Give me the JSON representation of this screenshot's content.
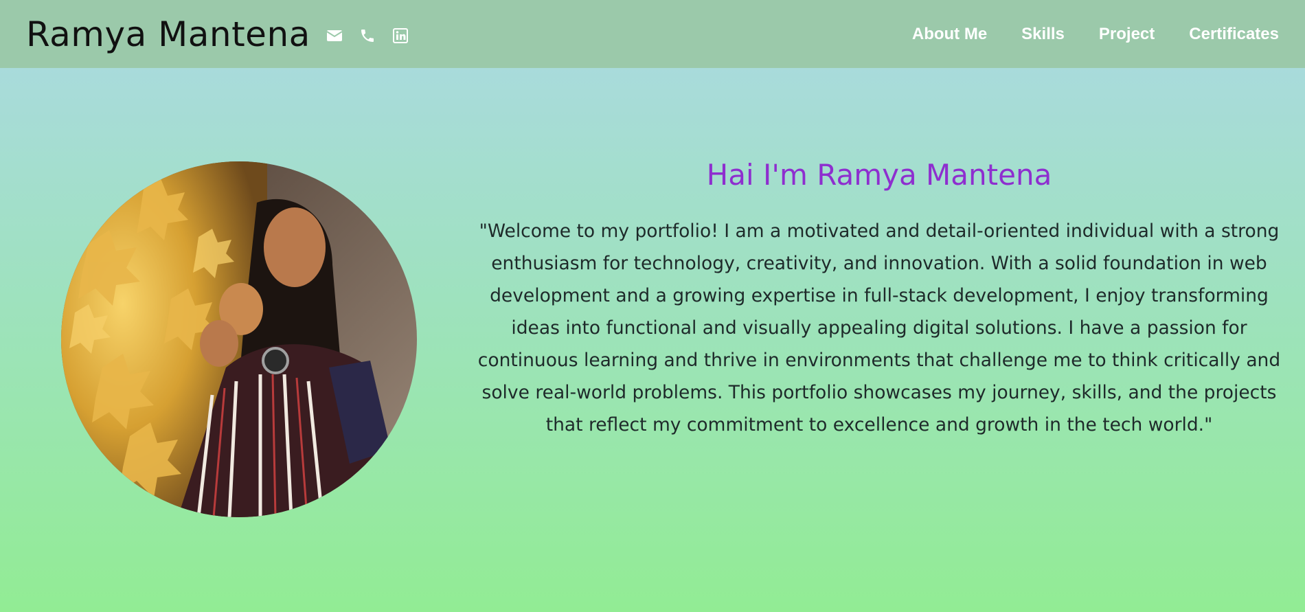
{
  "header": {
    "brand": "Ramya Mantena",
    "icons": [
      "envelope-icon",
      "phone-icon",
      "linkedin-icon"
    ],
    "nav": [
      "About Me",
      "Skills",
      "Project",
      "Certificates"
    ]
  },
  "hero": {
    "greeting": "Hai I'm Ramya Mantena",
    "intro": "\"Welcome to my portfolio! I am a motivated and detail-oriented individual with a strong enthusiasm for technology, creativity, and innovation. With a solid foundation in web development and a growing expertise in full-stack development, I enjoy transforming ideas into functional and visually appealing digital solutions. I have a passion for continuous learning and thrive in environments that challenge me to think critically and solve real-world problems. This portfolio showcases my journey, skills, and the projects that reflect my commitment to excellence and growth in the tech world.\""
  },
  "colors": {
    "navbar": "#9bc9aa",
    "greeting": "#8e2ecf",
    "nav_text": "#ffffff",
    "bg_top": "#acd9e4",
    "bg_bottom": "#92ec94"
  }
}
